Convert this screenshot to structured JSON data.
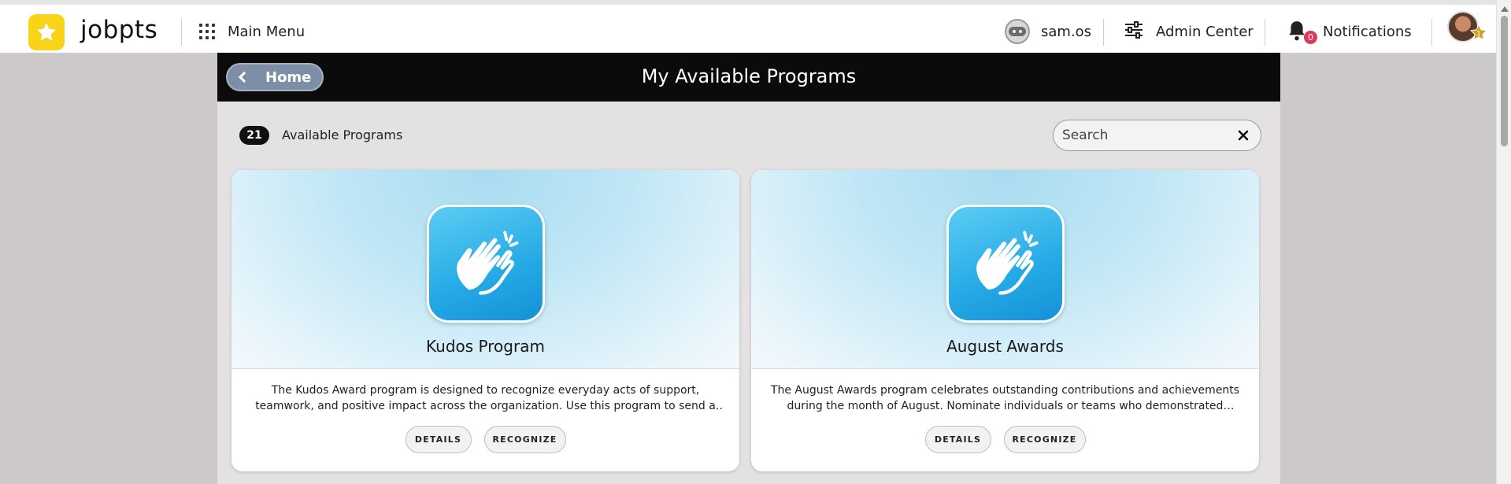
{
  "topbar": {
    "brand": "jobpts",
    "main_menu_label": "Main Menu",
    "assistant_label": "sam.os",
    "admin_label": "Admin Center",
    "notifications_label": "Notifications",
    "notifications_count": "0",
    "avatar_badge": "1",
    "icons": [
      "star-logo-icon",
      "grid-menu-icon",
      "robot-icon",
      "sliders-icon",
      "bell-icon",
      "user-avatar",
      "star-badge-icon"
    ]
  },
  "header": {
    "back_label": "Home",
    "title": "My Available Programs"
  },
  "toolbar": {
    "count": "21",
    "count_label": "Available Programs",
    "search_placeholder": "Search"
  },
  "programs": [
    {
      "title": "Kudos Program",
      "description": "The Kudos Award program is designed to recognize everyday acts of support, teamwork, and positive impact across the organization. Use this program to send a quick note of appreciatio...",
      "details_label": "DETAILS",
      "recognize_label": "RECOGNIZE",
      "icon": "clapping-hands-icon"
    },
    {
      "title": "August Awards",
      "description": "The August Awards program celebrates outstanding contributions and achievements during the month of August. Nominate individuals or teams who demonstrated exceptional...",
      "details_label": "DETAILS",
      "recognize_label": "RECOGNIZE",
      "icon": "clapping-hands-icon"
    }
  ],
  "colors": {
    "brand_yellow": "#f7d417",
    "header_black": "#0b0b0b",
    "home_button": "#7d8fa6",
    "icon_blue": "#25a9e6",
    "badge_red": "#e0385a"
  }
}
